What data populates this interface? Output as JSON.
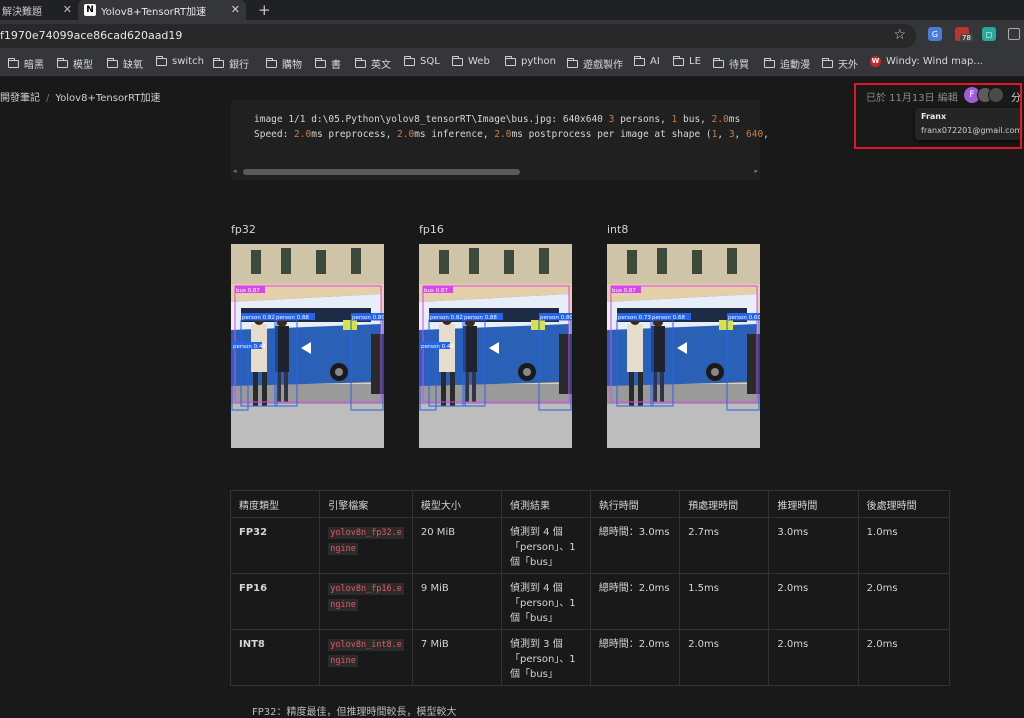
{
  "browser": {
    "tabs": [
      {
        "title": "解決難題",
        "active": false
      },
      {
        "title": "Yolov8+TensorRT加速",
        "favicon": "N",
        "active": true
      }
    ],
    "new_tab_symbol": "+",
    "url": "f1970e74099ace86cad620aad19",
    "extension_badge": "78",
    "bookmarks": [
      "暗黑",
      "模型",
      "缺氧",
      "switch",
      "銀行",
      "購物",
      "書",
      "英文",
      "SQL",
      "Web",
      "python",
      "遊戲製作",
      "AI",
      "LE",
      "待買",
      "追動漫",
      "天外",
      "Windy: Wind map..."
    ]
  },
  "notion": {
    "breadcrumb": [
      "開發筆記",
      "Yolov8+TensorRT加速"
    ],
    "breadcrumb_sep": "/",
    "edited": "已於 11月13日 編輯",
    "avatar_initial": "F",
    "share_label": "分",
    "tooltip": {
      "name": "Franx",
      "email": "franx072201@gmail.com"
    },
    "highlight_color": "#e0192b"
  },
  "code": {
    "line1_a": "image 1/1 d:\\05.Python\\yolov8_tensorRT\\Image\\bus.jpg: 640x640 ",
    "line1_n1": "3",
    "line1_b": " persons, ",
    "line1_n2": "1",
    "line1_c": " bus, ",
    "line1_n3": "2.0",
    "line1_d": "ms",
    "line2_a": "Speed: ",
    "line2_n1": "2.0",
    "line2_b": "ms preprocess, ",
    "line2_n2": "2.0",
    "line2_c": "ms inference, ",
    "line2_n3": "2.0",
    "line2_d": "ms postprocess per image at shape (",
    "line2_n4": "1",
    "line2_e": ", ",
    "line2_n5": "3",
    "line2_f": ", ",
    "line2_n6": "640",
    "line2_g": ","
  },
  "images": [
    {
      "label": "fp32",
      "detections": [
        {
          "name": "bus",
          "conf": "0.87"
        },
        {
          "name": "person",
          "conf": "0.82"
        },
        {
          "name": "person",
          "conf": "0.88"
        },
        {
          "name": "person",
          "conf": "0.80"
        },
        {
          "name": "person",
          "conf": "0.44"
        }
      ]
    },
    {
      "label": "fp16",
      "detections": [
        {
          "name": "bus",
          "conf": "0.87"
        },
        {
          "name": "person",
          "conf": "0.82"
        },
        {
          "name": "person",
          "conf": "0.88"
        },
        {
          "name": "person",
          "conf": "0.80"
        },
        {
          "name": "person",
          "conf": "0.44"
        }
      ]
    },
    {
      "label": "int8",
      "detections": [
        {
          "name": "bus",
          "conf": "0.87"
        },
        {
          "name": "person",
          "conf": "0.73"
        },
        {
          "name": "person",
          "conf": "0.68"
        },
        {
          "name": "person",
          "conf": "0.60"
        }
      ]
    }
  ],
  "table": {
    "headers": [
      "精度類型",
      "引擎檔案",
      "模型大小",
      "偵測結果",
      "執行時間",
      "預處理時間",
      "推理時間",
      "後處理時間"
    ],
    "rows": [
      {
        "precision": "FP32",
        "engine_1": "yolov8n_fp32.e",
        "engine_2": "ngine",
        "size": "20 MiB",
        "result_1": "偵測到 4 個",
        "result_2": "「person」、1",
        "result_3": "個「bus」",
        "exec": "總時間：3.0ms",
        "pre": "2.7ms",
        "infer": "3.0ms",
        "post": "1.0ms"
      },
      {
        "precision": "FP16",
        "engine_1": "yolov8n_fp16.e",
        "engine_2": "ngine",
        "size": "9 MiB",
        "result_1": "偵測到 4 個",
        "result_2": "「person」、1",
        "result_3": "個「bus」",
        "exec": "總時間：2.0ms",
        "pre": "1.5ms",
        "infer": "2.0ms",
        "post": "2.0ms"
      },
      {
        "precision": "INT8",
        "engine_1": "yolov8n_int8.e",
        "engine_2": "ngine",
        "size": "7 MiB",
        "result_1": "偵測到 3 個",
        "result_2": "「person」、1",
        "result_3": "個「bus」",
        "exec": "總時間：2.0ms",
        "pre": "2.0ms",
        "infer": "2.0ms",
        "post": "2.0ms"
      }
    ]
  },
  "bottom_text": "FP32：精度最佳，但推理時間較長，模型較大"
}
